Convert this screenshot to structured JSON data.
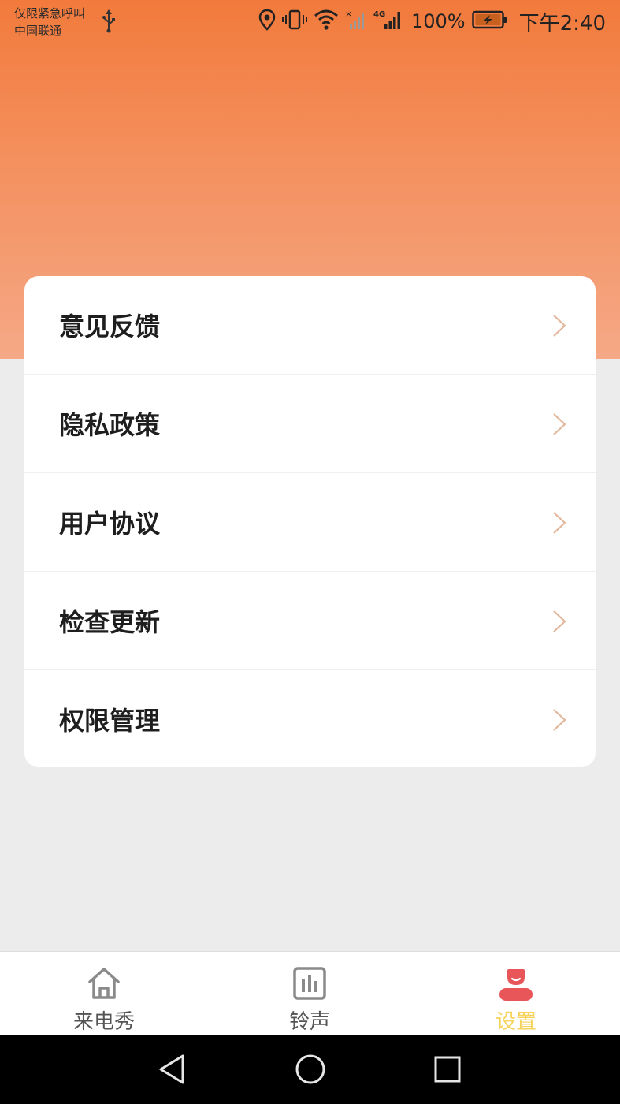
{
  "status_bar": {
    "carrier_line1": "仅限紧急呼叫",
    "carrier_line2": "中国联通",
    "network": "4G",
    "battery": "100%",
    "time": "下午2:40"
  },
  "menu": {
    "items": [
      {
        "label": "意见反馈"
      },
      {
        "label": "隐私政策"
      },
      {
        "label": "用户协议"
      },
      {
        "label": "检查更新"
      },
      {
        "label": "权限管理"
      }
    ]
  },
  "tabs": [
    {
      "label": "来电秀",
      "icon": "home-icon",
      "active": false
    },
    {
      "label": "铃声",
      "icon": "bar-chart-icon",
      "active": false
    },
    {
      "label": "设置",
      "icon": "user-icon",
      "active": true
    }
  ],
  "colors": {
    "header_gradient_top": "#f27a3c",
    "header_gradient_bottom": "#f5a886",
    "active_tab_icon": "#e8565a",
    "active_tab_label": "#f6d35c",
    "chevron": "#e2b79b"
  },
  "nav": {
    "back": "back-icon",
    "home": "home-circle-icon",
    "recents": "recents-icon"
  }
}
